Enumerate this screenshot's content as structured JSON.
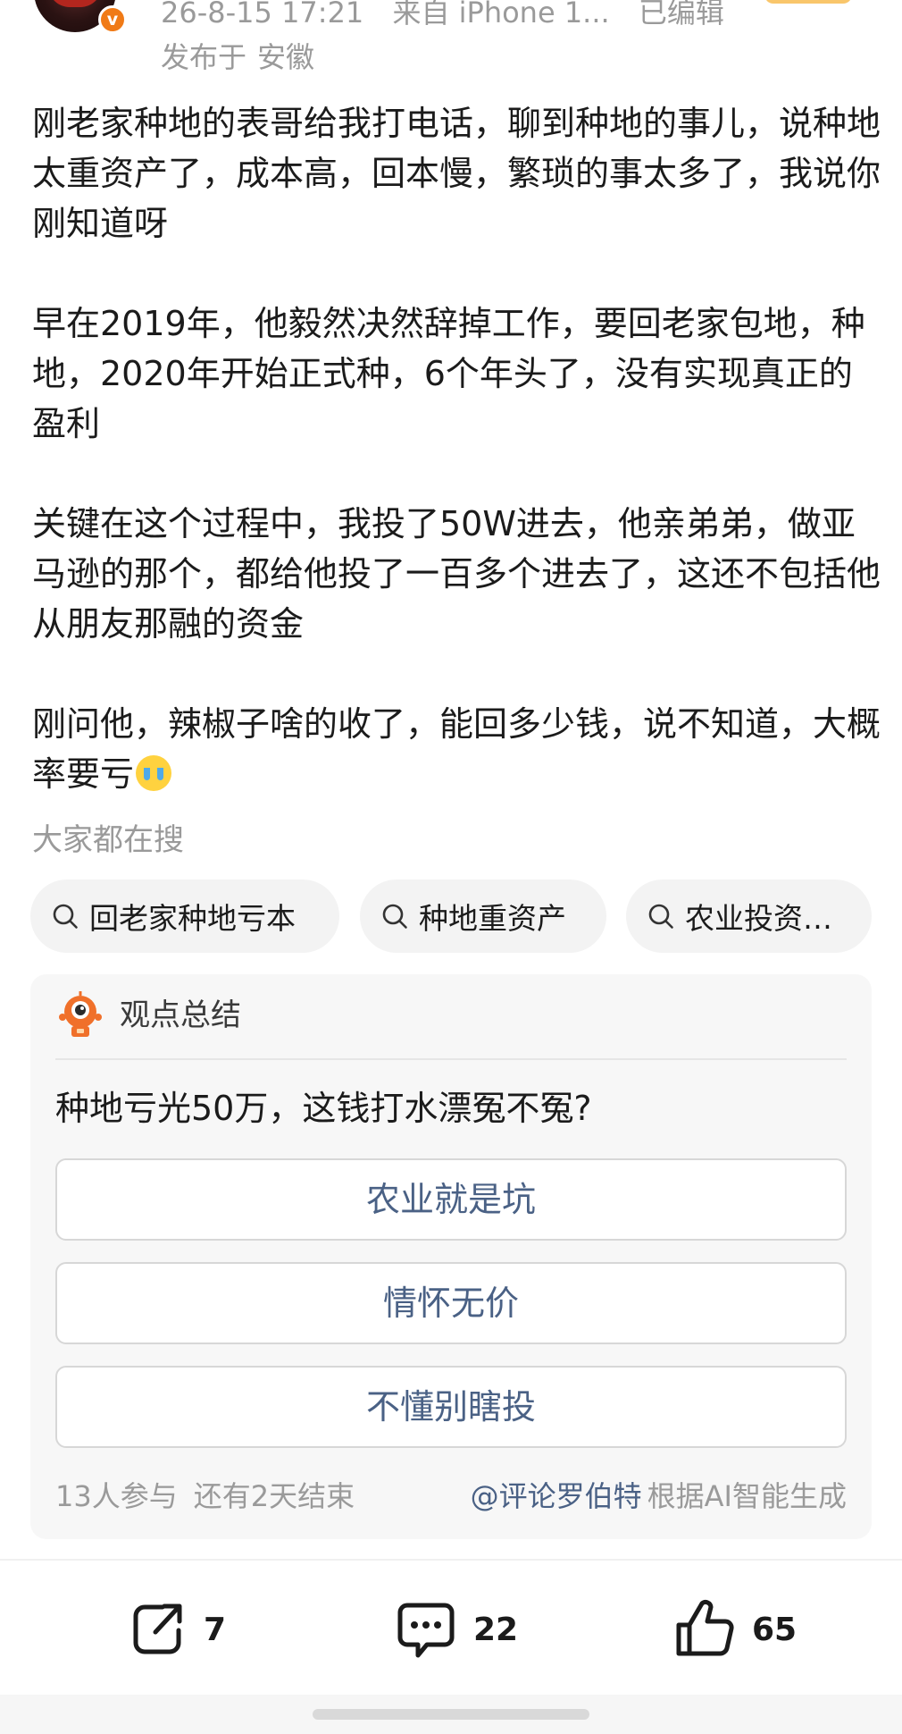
{
  "post": {
    "meta": {
      "time": "26-8-15 17:21",
      "source": "来自 iPhone 1...",
      "edited": "已编辑",
      "location_prefix": "发布于",
      "location": "安徽"
    },
    "paragraphs": [
      "刚老家种地的表哥给我打电话，聊到种地的事儿，说种地太重资产了，成本高，回本慢，繁琐的事太多了，我说你刚知道呀",
      "早在2019年，他毅然决然辞掉工作，要回老家包地，种地，2020年开始正式种，6个年头了，没有实现真正的盈利",
      "关键在这个过程中，我投了50W进去，他亲弟弟，做亚马逊的那个，都给他投了一百多个进去了，这还不包括他从朋友那融的资金",
      "刚问他，辣椒子啥的收了，能回多少钱，说不知道，大概率要亏"
    ],
    "verified_icon": "v",
    "emoji": "crying-face-emoji"
  },
  "search": {
    "title": "大家都在搜",
    "chips": [
      "回老家种地亏本",
      "种地重资产",
      "农业投资…"
    ]
  },
  "opinion": {
    "title": "观点总结",
    "question": "种地亏光50万，这钱打水漂冤不冤?",
    "options": [
      "农业就是坑",
      "情怀无价",
      "不懂别瞎投"
    ],
    "participants": "13人参与",
    "remaining": "还有2天结束",
    "mention": "@评论罗伯特",
    "generated": "根据AI智能生成"
  },
  "actions": {
    "share_count": "7",
    "comment_count": "22",
    "like_count": "65"
  },
  "colors": {
    "accent_link": "#4a6185",
    "muted_text": "#9a9a9a",
    "verified_badge": "#f07a16"
  }
}
